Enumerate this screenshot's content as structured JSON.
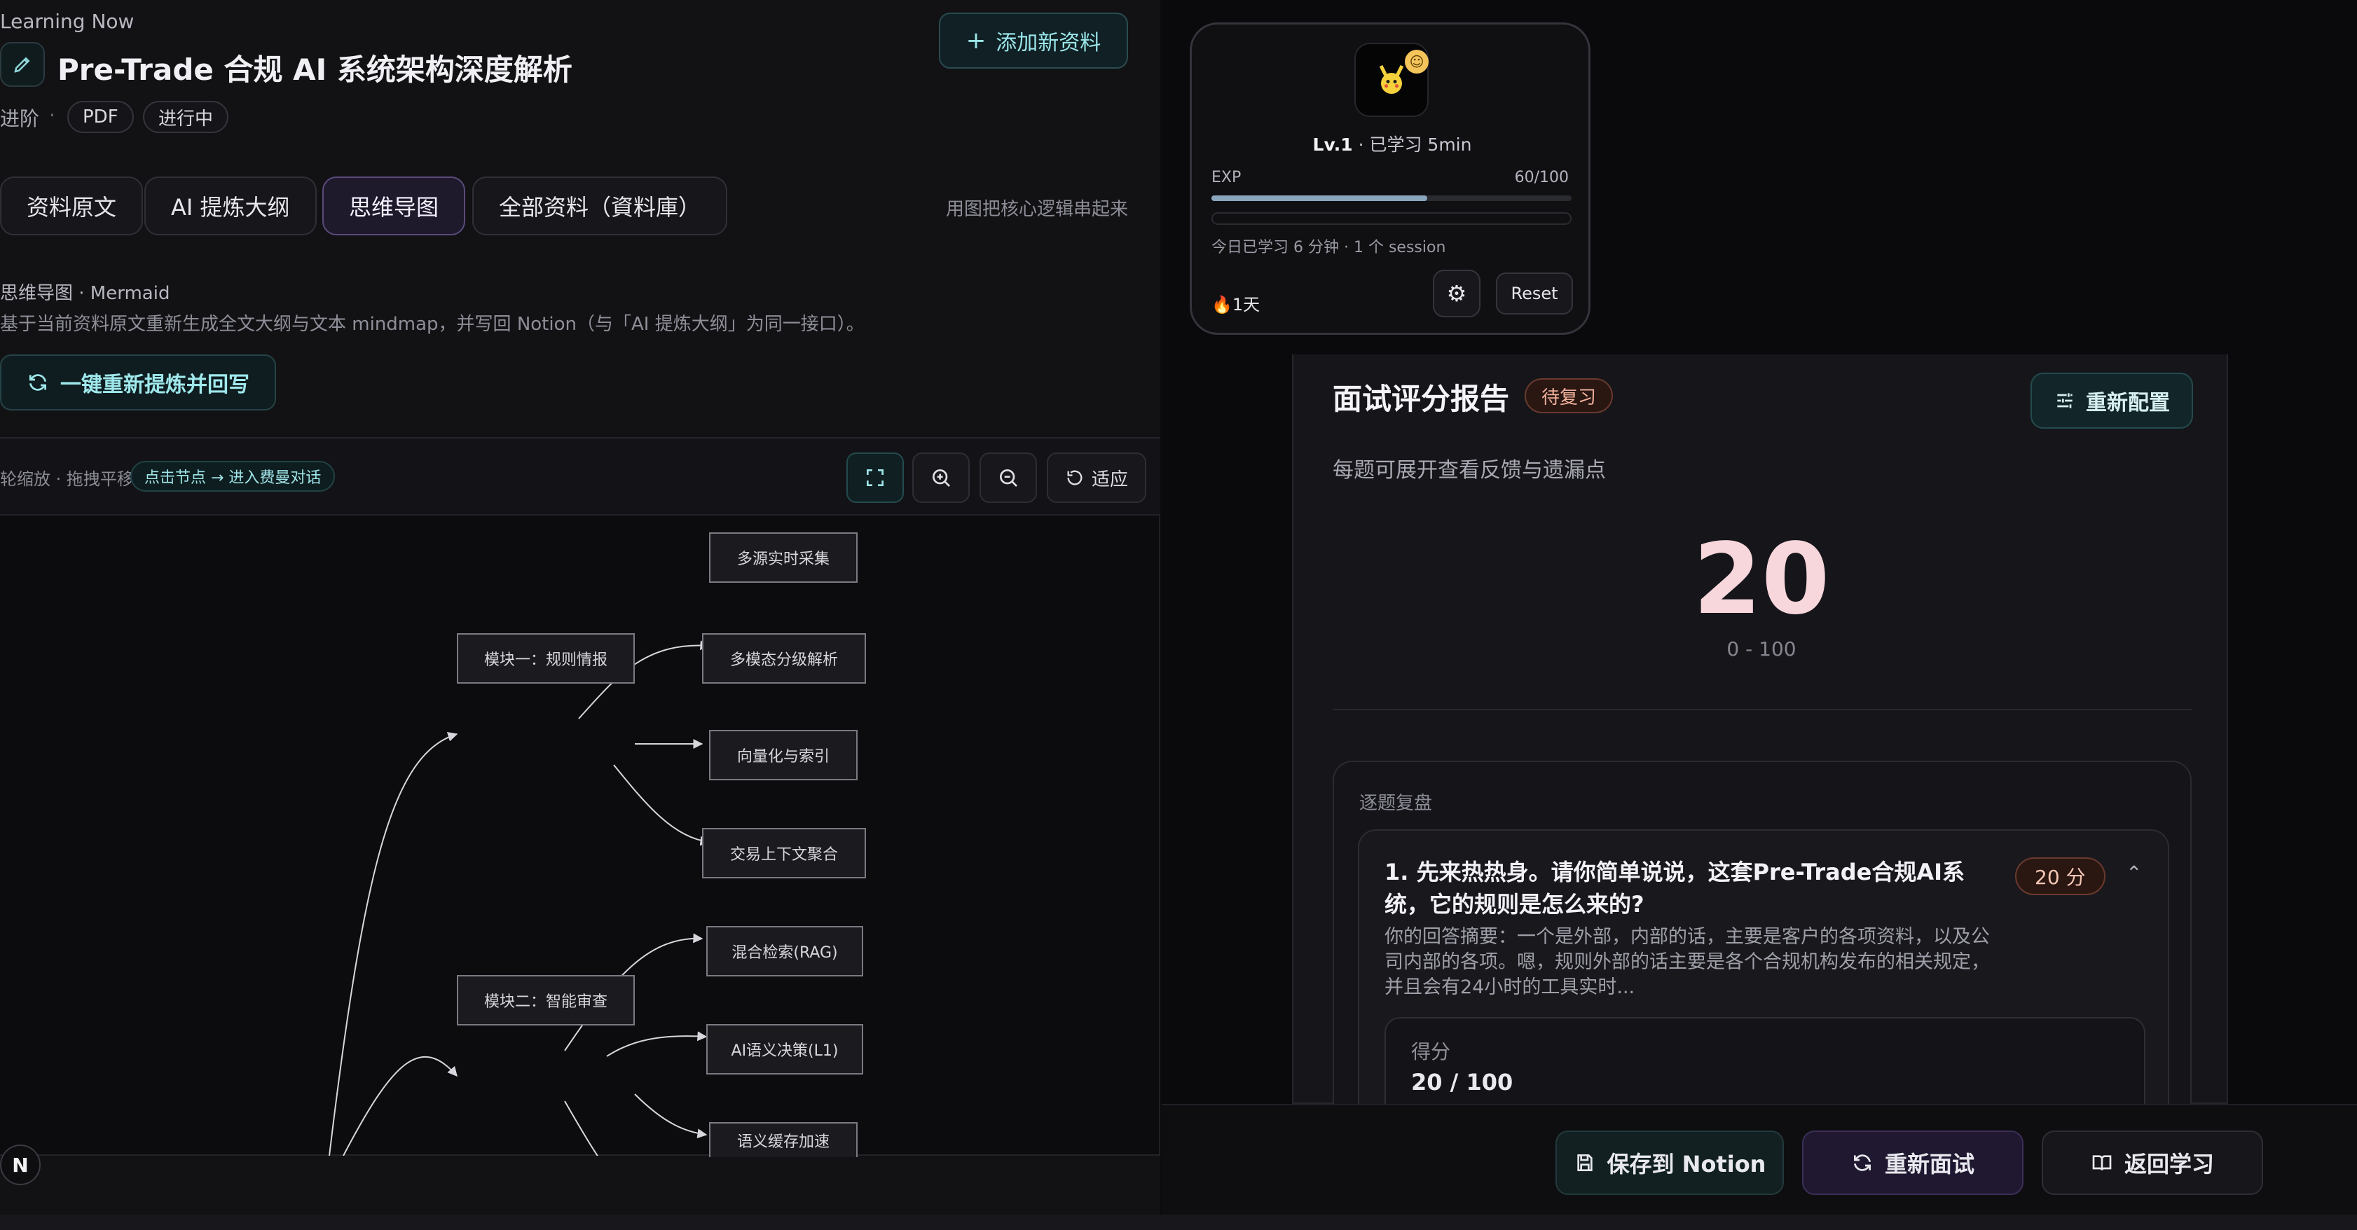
{
  "header": {
    "kicker": "Learning Now",
    "title": "Pre-Trade 合规 AI 系统架构深度解析",
    "level": "进阶",
    "separator": "·",
    "chips": [
      "PDF",
      "进行中"
    ],
    "add_button": "添加新资料"
  },
  "tabs": [
    {
      "label": "资料原文",
      "active": false
    },
    {
      "label": "AI 提炼大纲",
      "active": false
    },
    {
      "label": "思维导图",
      "active": true
    },
    {
      "label": "全部资料（資料庫）",
      "active": false
    }
  ],
  "tabs_hint": "用图把核心逻辑串起来",
  "mindmap_section": {
    "title": "思维导图 · Mermaid",
    "description": "基于当前资料原文重新生成全文大纲与文本 mindmap，并写回 Notion（与「AI 提炼大纲」为同一接口）。",
    "regen_button": "一键重新提炼并回写"
  },
  "canvas": {
    "hint": "轮缩放 · 拖拽平移",
    "badge": "点击节点 → 进入费曼对话",
    "fit_label": "适应",
    "nodes": {
      "m1": "模块一：规则情报",
      "m1a": "多源实时采集",
      "m1b": "多模态分级解析",
      "m1c": "向量化与索引",
      "m2": "模块二：智能审查",
      "m2a": "交易上下文聚合",
      "m2b": "混合检索(RAG)",
      "m2c": "AI语义决策(L1)",
      "m2d": "语义缓存加速"
    }
  },
  "notion_fab": "N",
  "profile": {
    "level": "Lv.1",
    "studied": "· 已学习 5min",
    "exp_label": "EXP",
    "exp_value": "60/100",
    "exp_progress": 0.6,
    "today": "今日已学习 6 分钟 · 1 个 session",
    "streak": "🔥1天",
    "reset": "Reset"
  },
  "report": {
    "title": "面试评分报告",
    "badge": "待复习",
    "reconfigure": "重新配置",
    "subtitle": "每题可展开查看反馈与遗漏点",
    "score": "20",
    "range": "0 - 100",
    "review_title": "逐题复盘",
    "questions": [
      {
        "title": "1. 先来热热身。请你简单说说，这套Pre-Trade合规AI系统，它的规则是怎么来的?",
        "score_badge": "20 分",
        "answer": "你的回答摘要：一个是外部，内部的话，主要是客户的各项资料，以及公司内部的各项。嗯，规则外部的话主要是各个合规机构发布的相关规定，并且会有24小时的工具实时...",
        "score_label": "得分",
        "score_value": "20 / 100"
      }
    ]
  },
  "footer": {
    "save_notion": "保存到 Notion",
    "retry": "重新面试",
    "back": "返回学习"
  }
}
